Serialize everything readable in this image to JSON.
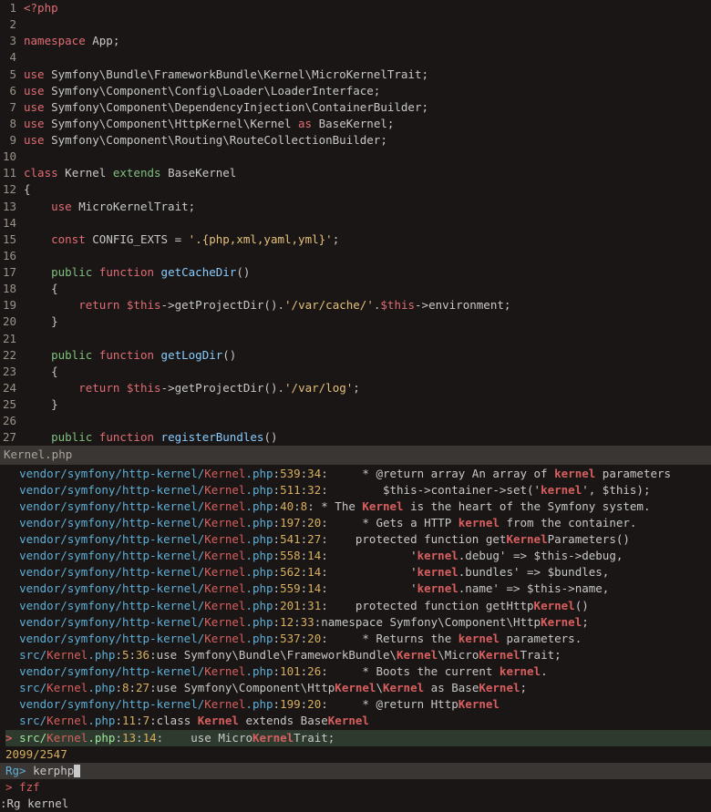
{
  "editor": {
    "lines": [
      {
        "n": 1,
        "html": "<span class='kw'>&lt;?php</span>"
      },
      {
        "n": 2,
        "html": ""
      },
      {
        "n": 3,
        "html": "<span class='kw'>namespace</span> App;"
      },
      {
        "n": 4,
        "html": ""
      },
      {
        "n": 5,
        "html": "<span class='kw'>use</span> Symfony\\Bundle\\FrameworkBundle\\Kernel\\MicroKernelTrait;"
      },
      {
        "n": 6,
        "html": "<span class='kw'>use</span> Symfony\\Component\\Config\\Loader\\LoaderInterface;"
      },
      {
        "n": 7,
        "html": "<span class='kw'>use</span> Symfony\\Component\\DependencyInjection\\ContainerBuilder;"
      },
      {
        "n": 8,
        "html": "<span class='kw'>use</span> Symfony\\Component\\HttpKernel\\Kernel <span class='kw'>as</span> BaseKernel;"
      },
      {
        "n": 9,
        "html": "<span class='kw'>use</span> Symfony\\Component\\Routing\\RouteCollectionBuilder;"
      },
      {
        "n": 10,
        "html": ""
      },
      {
        "n": 11,
        "html": "<span class='kw'>class</span> Kernel <span class='kw2'>extends</span> BaseKernel"
      },
      {
        "n": 12,
        "html": "{"
      },
      {
        "n": 13,
        "html": "    <span class='kw'>use</span> MicroKernelTrait;"
      },
      {
        "n": 14,
        "html": ""
      },
      {
        "n": 15,
        "html": "    <span class='kw'>const</span> CONFIG_EXTS = <span class='str'>'.{php,xml,yaml,yml}'</span>;"
      },
      {
        "n": 16,
        "html": ""
      },
      {
        "n": 17,
        "html": "    <span class='kw2'>public</span> <span class='kw'>function</span> <span class='fn'>getCacheDir</span>()"
      },
      {
        "n": 18,
        "html": "    {"
      },
      {
        "n": 19,
        "html": "        <span class='kw'>return</span> <span class='kw'>$this</span>-&gt;getProjectDir().<span class='str'>'/var/cache/'</span>.<span class='kw'>$this</span>-&gt;environment;"
      },
      {
        "n": 20,
        "html": "    }"
      },
      {
        "n": 21,
        "html": ""
      },
      {
        "n": 22,
        "html": "    <span class='kw2'>public</span> <span class='kw'>function</span> <span class='fn'>getLogDir</span>()"
      },
      {
        "n": 23,
        "html": "    {"
      },
      {
        "n": 24,
        "html": "        <span class='kw'>return</span> <span class='kw'>$this</span>-&gt;getProjectDir().<span class='str'>'/var/log'</span>;"
      },
      {
        "n": 25,
        "html": "    }"
      },
      {
        "n": 26,
        "html": ""
      },
      {
        "n": 27,
        "html": "    <span class='kw2'>public</span> <span class='kw'>function</span> <span class='fn'>registerBundles</span>()"
      }
    ]
  },
  "filename": "Kernel.php",
  "results": [
    {
      "path": "vendor/symfony/http-kernel/",
      "file": "Kernel",
      "ext": ".php",
      "ln": "539",
      "col": "34",
      "txt": "     * @return array An array of ",
      "m": "kernel",
      "after": " parameters"
    },
    {
      "path": "vendor/symfony/http-kernel/",
      "file": "Kernel",
      "ext": ".php",
      "ln": "511",
      "col": "32",
      "txt": "        $this->container->set('",
      "m": "kernel",
      "after": "', $this);"
    },
    {
      "path": "vendor/symfony/http-kernel/",
      "file": "Kernel",
      "ext": ".php",
      "ln": "40",
      "col": "8",
      "txt": " * The ",
      "m": "Kernel",
      "after": " is the heart of the Symfony system."
    },
    {
      "path": "vendor/symfony/http-kernel/",
      "file": "Kernel",
      "ext": ".php",
      "ln": "197",
      "col": "20",
      "txt": "     * Gets a HTTP ",
      "m": "kernel",
      "after": " from the container."
    },
    {
      "path": "vendor/symfony/http-kernel/",
      "file": "Kernel",
      "ext": ".php",
      "ln": "541",
      "col": "27",
      "txt": "    protected function get",
      "m": "Kernel",
      "after": "Parameters()"
    },
    {
      "path": "vendor/symfony/http-kernel/",
      "file": "Kernel",
      "ext": ".php",
      "ln": "558",
      "col": "14",
      "txt": "            '",
      "m": "kernel",
      "after": ".debug' => $this->debug,"
    },
    {
      "path": "vendor/symfony/http-kernel/",
      "file": "Kernel",
      "ext": ".php",
      "ln": "562",
      "col": "14",
      "txt": "            '",
      "m": "kernel",
      "after": ".bundles' => $bundles,"
    },
    {
      "path": "vendor/symfony/http-kernel/",
      "file": "Kernel",
      "ext": ".php",
      "ln": "559",
      "col": "14",
      "txt": "            '",
      "m": "kernel",
      "after": ".name' => $this->name,"
    },
    {
      "path": "vendor/symfony/http-kernel/",
      "file": "Kernel",
      "ext": ".php",
      "ln": "201",
      "col": "31",
      "txt": "    protected function getHttp",
      "m": "Kernel",
      "after": "()"
    },
    {
      "path": "vendor/symfony/http-kernel/",
      "file": "Kernel",
      "ext": ".php",
      "ln": "12",
      "col": "33",
      "txt": "namespace Symfony\\Component\\Http",
      "m": "Kernel",
      "after": ";"
    },
    {
      "path": "vendor/symfony/http-kernel/",
      "file": "Kernel",
      "ext": ".php",
      "ln": "537",
      "col": "20",
      "txt": "     * Returns the ",
      "m": "kernel",
      "after": " parameters."
    },
    {
      "path": "src/",
      "file": "Kernel",
      "ext": ".php",
      "ln": "5",
      "col": "36",
      "txt": "use Symfony\\Bundle\\FrameworkBundle\\",
      "m": "Kernel",
      "after": "\\Micro",
      "m2": "Kernel",
      "after2": "Trait;"
    },
    {
      "path": "vendor/symfony/http-kernel/",
      "file": "Kernel",
      "ext": ".php",
      "ln": "101",
      "col": "26",
      "txt": "     * Boots the current ",
      "m": "kernel",
      "after": "."
    },
    {
      "path": "src/",
      "file": "Kernel",
      "ext": ".php",
      "ln": "8",
      "col": "27",
      "txt": "use Symfony\\Component\\Http",
      "m": "Kernel",
      "after": "\\",
      "m2": "Kernel",
      "after2": " as Base",
      "m3": "Kernel",
      "after3": ";"
    },
    {
      "path": "vendor/symfony/http-kernel/",
      "file": "Kernel",
      "ext": ".php",
      "ln": "199",
      "col": "20",
      "txt": "     * @return Http",
      "m": "Kernel",
      "after": ""
    },
    {
      "path": "src/",
      "file": "Kernel",
      "ext": ".php",
      "ln": "11",
      "col": "7",
      "txt": "class ",
      "m": "Kernel",
      "after": " extends Base",
      "m2": "Kernel",
      "after2": ""
    }
  ],
  "selected": {
    "path": "src/",
    "file": "Kernel",
    "ext": ".php",
    "ln": "13",
    "col": "14",
    "txt": "    use Micro",
    "m": "Kernel",
    "after": "Trait;"
  },
  "count": "2099/2547",
  "prompt_label": "Rg> ",
  "prompt_value": "kerphp",
  "fzf": "> fzf",
  "cmd": ":Rg kernel"
}
